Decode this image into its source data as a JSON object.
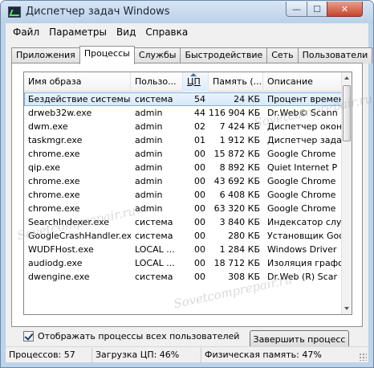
{
  "window": {
    "title": "Диспетчер задач Windows",
    "minimize_glyph": "—",
    "maximize_glyph": "☐",
    "close_glyph": "✕"
  },
  "menu": [
    "Файл",
    "Параметры",
    "Вид",
    "Справка"
  ],
  "tabs": [
    "Приложения",
    "Процессы",
    "Службы",
    "Быстродействие",
    "Сеть",
    "Пользователи"
  ],
  "active_tab": "Процессы",
  "columns": [
    "Имя образа",
    "Пользо...",
    "ЦП",
    "Память (...",
    "Описание"
  ],
  "rows": [
    {
      "name": "Бездействие системы",
      "user": "система",
      "cpu": "54",
      "mem": "24 КБ",
      "desc": "Процент времен"
    },
    {
      "name": "drweb32w.exe",
      "user": "admin",
      "cpu": "44",
      "mem": "116 904 КБ",
      "desc": "Dr.Web© Scann"
    },
    {
      "name": "dwm.exe",
      "user": "admin",
      "cpu": "02",
      "mem": "7 424 КБ",
      "desc": "Диспетчер окон"
    },
    {
      "name": "taskmgr.exe",
      "user": "admin",
      "cpu": "01",
      "mem": "1 912 КБ",
      "desc": "Диспетчер задач"
    },
    {
      "name": "chrome.exe",
      "user": "admin",
      "cpu": "00",
      "mem": "15 872 КБ",
      "desc": "Google Chrome"
    },
    {
      "name": "qip.exe",
      "user": "admin",
      "cpu": "00",
      "mem": "8 892 КБ",
      "desc": "Quiet Internet P"
    },
    {
      "name": "chrome.exe",
      "user": "admin",
      "cpu": "00",
      "mem": "43 692 КБ",
      "desc": "Google Chrome"
    },
    {
      "name": "chrome.exe",
      "user": "admin",
      "cpu": "00",
      "mem": "6 408 КБ",
      "desc": "Google Chrome"
    },
    {
      "name": "chrome.exe",
      "user": "admin",
      "cpu": "00",
      "mem": "63 320 КБ",
      "desc": "Google Chrome"
    },
    {
      "name": "SearchIndexer.exe",
      "user": "система",
      "cpu": "00",
      "mem": "3 840 КБ",
      "desc": "Индексатор слу"
    },
    {
      "name": "GoogleCrashHandler.exe",
      "user": "система",
      "cpu": "00",
      "mem": "280 КБ",
      "desc": "Установщик Goo"
    },
    {
      "name": "WUDFHost.exe",
      "user": "LOCAL ...",
      "cpu": "00",
      "mem": "1 284 КБ",
      "desc": "Windows Driver"
    },
    {
      "name": "audiodg.exe",
      "user": "LOCAL ...",
      "cpu": "00",
      "mem": "18 712 КБ",
      "desc": "Изоляция графо"
    },
    {
      "name": "dwengine.exe",
      "user": "система",
      "cpu": "00",
      "mem": "308 КБ",
      "desc": "Dr.Web (R) Scar"
    }
  ],
  "show_all_label": "Отображать процессы всех пользователей",
  "end_process_label": "Завершить процесс",
  "status": {
    "processes": "Процессов: 57",
    "cpu": "Загрузка ЦП: 46%",
    "memory": "Физическая память: 47%"
  },
  "watermark": "Sovetcomprepair.ru",
  "colors": {
    "highlight_line": "#e5202a",
    "selected_row": "#d6e8fb"
  }
}
